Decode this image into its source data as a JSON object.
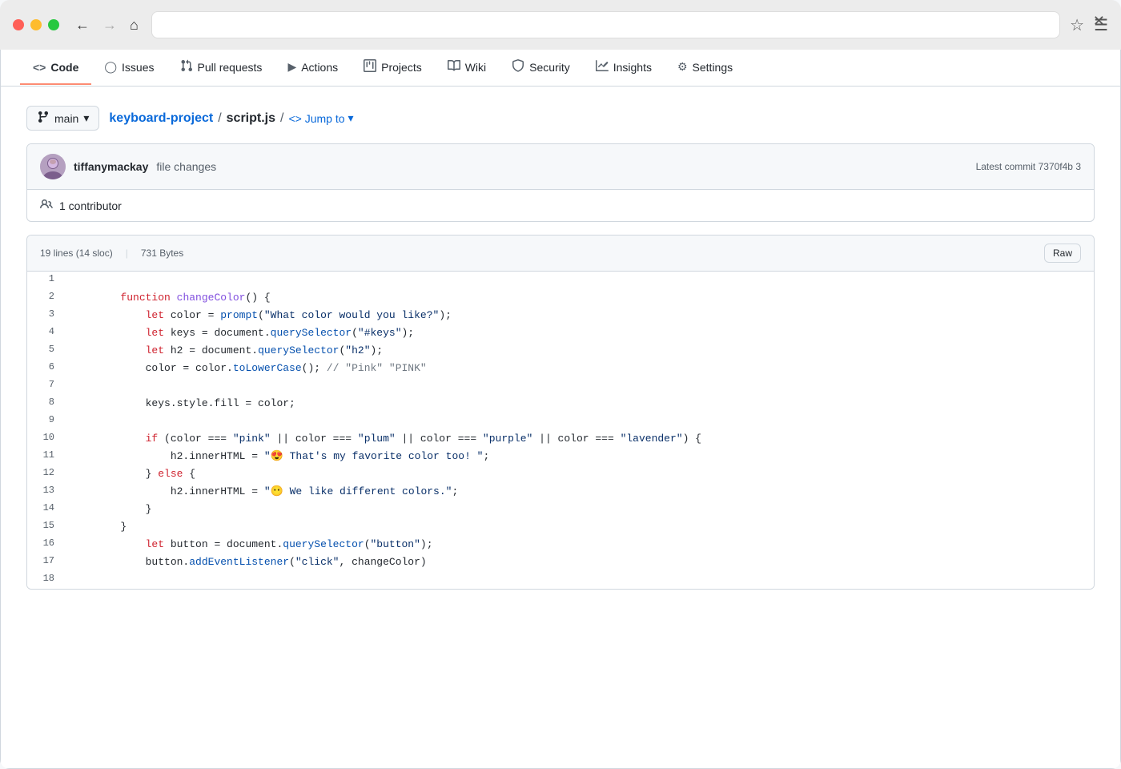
{
  "browser": {
    "dots": [
      "red",
      "yellow",
      "green"
    ],
    "back_icon": "←",
    "forward_icon": "→",
    "home_icon": "⌂",
    "addressbar_value": "",
    "favorite_icon": "☆",
    "menu_icon": "≡",
    "close_icon": "✕"
  },
  "nav": {
    "tabs": [
      {
        "id": "code",
        "label": "Code",
        "icon": "<>",
        "active": true
      },
      {
        "id": "issues",
        "label": "Issues",
        "icon": "⊙"
      },
      {
        "id": "pull-requests",
        "label": "Pull requests",
        "icon": "⇄"
      },
      {
        "id": "actions",
        "label": "Actions",
        "icon": "▶"
      },
      {
        "id": "projects",
        "label": "Projects",
        "icon": "▦"
      },
      {
        "id": "wiki",
        "label": "Wiki",
        "icon": "📖"
      },
      {
        "id": "security",
        "label": "Security",
        "icon": "🛡"
      },
      {
        "id": "insights",
        "label": "Insights",
        "icon": "📈"
      },
      {
        "id": "settings",
        "label": "Settings",
        "icon": "⚙"
      }
    ]
  },
  "file": {
    "branch": "main",
    "branch_icon": "⎇",
    "repo": "keyboard-project",
    "filename": "script.js",
    "jump_to": "<> Jump to",
    "commit_author": "tiffanymackay",
    "commit_message": "file changes",
    "latest_commit": "Latest commit 7370f4b 3",
    "contributors": "1 contributor",
    "lines_info": "19 lines (14 sloc)",
    "bytes_info": "731 Bytes",
    "raw_label": "Raw"
  },
  "code": {
    "lines": [
      {
        "num": 1,
        "text": ""
      },
      {
        "num": 2,
        "text": "        function changeColor() {"
      },
      {
        "num": 3,
        "text": "            let color = prompt(\"What color would you like?\");"
      },
      {
        "num": 4,
        "text": "            let keys = document.querySelector(\"#keys\");"
      },
      {
        "num": 5,
        "text": "            let h2 = document.querySelector(\"h2\");"
      },
      {
        "num": 6,
        "text": "            color = color.toLowerCase(); // \"Pink\" \"PINK\""
      },
      {
        "num": 7,
        "text": ""
      },
      {
        "num": 8,
        "text": "            keys.style.fill = color;"
      },
      {
        "num": 9,
        "text": ""
      },
      {
        "num": 10,
        "text": "            if (color === \"pink\" || color === \"plum\" || color === \"purple\" || color === \"lavender\") {"
      },
      {
        "num": 11,
        "text": "                h2.innerHTML = \"😍 That's my favorite color too! \";"
      },
      {
        "num": 12,
        "text": "            } else {"
      },
      {
        "num": 13,
        "text": "                h2.innerHTML = \"😶 We like different colors.\";"
      },
      {
        "num": 14,
        "text": "            }"
      },
      {
        "num": 15,
        "text": "        }"
      },
      {
        "num": 16,
        "text": "            let button = document.querySelector(\"button\");"
      },
      {
        "num": 17,
        "text": "            button.addEventListener(\"click\", changeColor)"
      },
      {
        "num": 18,
        "text": ""
      }
    ]
  }
}
